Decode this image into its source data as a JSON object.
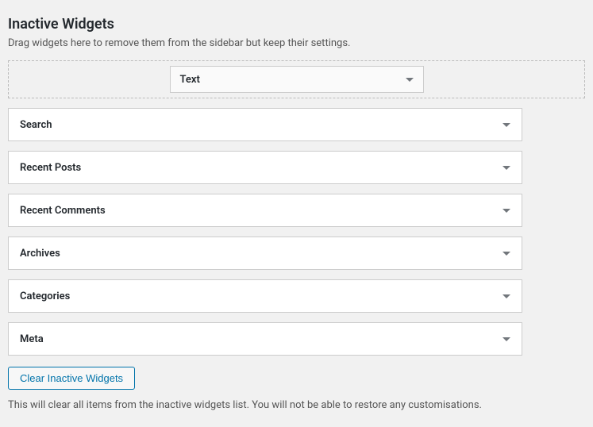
{
  "title": "Inactive Widgets",
  "description": "Drag widgets here to remove them from the sidebar but keep their settings.",
  "dragItem": {
    "label": "Text"
  },
  "widgets": [
    {
      "label": "Search"
    },
    {
      "label": "Recent Posts"
    },
    {
      "label": "Recent Comments"
    },
    {
      "label": "Archives"
    },
    {
      "label": "Categories"
    },
    {
      "label": "Meta"
    }
  ],
  "clearButton": "Clear Inactive Widgets",
  "footerNote": "This will clear all items from the inactive widgets list. You will not be able to restore any customisations."
}
